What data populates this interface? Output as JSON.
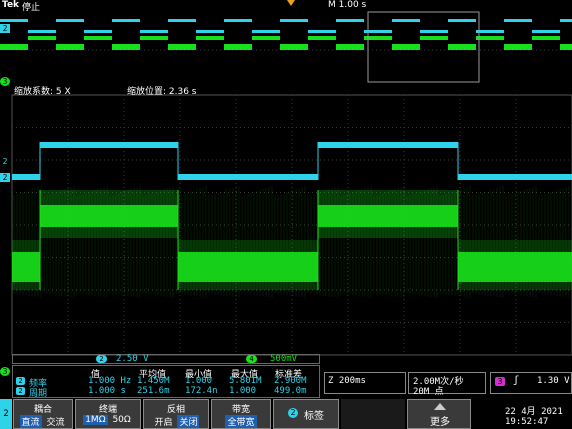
{
  "header": {
    "brand": "Tek",
    "run_state": "停止",
    "timebase": "M 1.00 s"
  },
  "zoom": {
    "factor_label": "缩放系数: 5 X",
    "position_label": "缩放位置: 2.36 s"
  },
  "channel_bar": {
    "ch2_num": "2",
    "ch2_scale": "2.50 V",
    "ch4_num": "4",
    "ch4_scale": "500mV"
  },
  "measurements": {
    "headers": [
      "值",
      "平均值",
      "最小值",
      "最大值",
      "标准差"
    ],
    "rows": [
      {
        "ch": "2",
        "name": "频率",
        "values": [
          "1.000 Hz",
          "1.450M",
          "1.000",
          "5.801M",
          "2.900M"
        ]
      },
      {
        "ch": "2",
        "name": "周期",
        "values": [
          "1.000 s",
          "251.6m",
          "172.4n",
          "1.000",
          "499.0m"
        ]
      }
    ]
  },
  "status": {
    "zoom_time": "Z 200ms",
    "sample_rate": "2.00M次/秒",
    "record_length": "20M 点",
    "trigger_ch": "3",
    "trigger_level": "1.30 V"
  },
  "bottom": {
    "ch_num": "2",
    "coupling_title": "耦合",
    "coupling_opts": [
      "直流",
      "交流"
    ],
    "termination_title": "终端",
    "termination_opts": [
      "1MΩ",
      "50Ω"
    ],
    "invert_title": "反相",
    "invert_opts": [
      "开启",
      "关闭"
    ],
    "bandwidth_title": "带宽",
    "bandwidth_value": "全带宽",
    "label_num": "2",
    "label_text": "标签",
    "more_text": "更多",
    "date": "22 4月  2021",
    "time": "19:52:47"
  },
  "colors": {
    "cyan": "#2ed3ea",
    "green": "#18e01a",
    "magenta": "#d62fd0",
    "orange": "#f0a020"
  }
}
